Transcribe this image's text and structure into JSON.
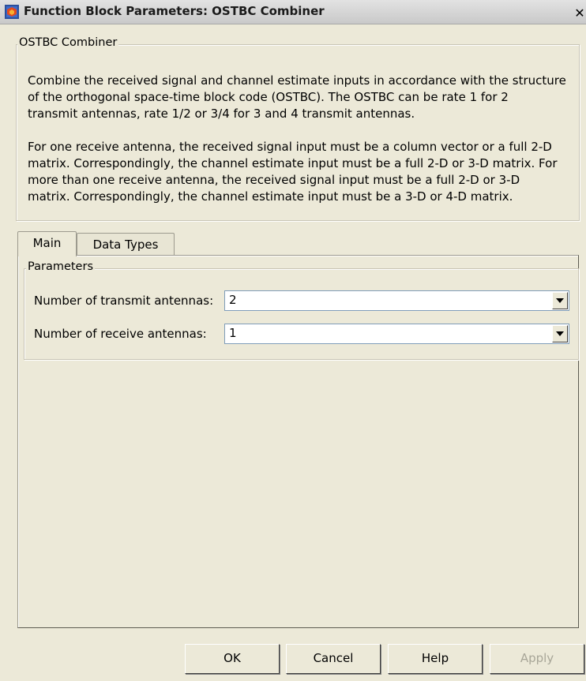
{
  "window": {
    "title": "Function Block Parameters: OSTBC Combiner",
    "close_glyph": "✕"
  },
  "block": {
    "name": "OSTBC Combiner",
    "description_lines": [
      "Combine the received signal and channel estimate inputs in accordance with the structure",
      "of the orthogonal space-time block code (OSTBC). The OSTBC can be rate 1 for 2",
      "transmit antennas, rate 1/2 or 3/4 for 3 and 4 transmit antennas.",
      "",
      "For one receive antenna, the received signal input must be a column vector or a full 2-D",
      "matrix. Correspondingly, the channel estimate input must be a full 2-D or 3-D matrix. For",
      "more than one receive antenna, the received signal input must be a full 2-D or 3-D",
      "matrix. Correspondingly, the channel estimate input must be a 3-D or 4-D matrix."
    ]
  },
  "tabs": [
    {
      "label": "Main",
      "active": true
    },
    {
      "label": "Data Types",
      "active": false
    }
  ],
  "parameters": {
    "group_label": "Parameters",
    "transmit": {
      "label": "Number of transmit antennas:",
      "value": "2"
    },
    "receive": {
      "label": "Number of receive antennas:",
      "value": "1"
    }
  },
  "buttons": {
    "ok": "OK",
    "cancel": "Cancel",
    "help": "Help",
    "apply": "Apply"
  },
  "icons": {
    "app": "simulink-block-icon",
    "close": "close-icon",
    "dropdown": "chevron-down-icon"
  },
  "colors": {
    "background": "#ece9d8",
    "disabled_text": "#a8a698",
    "combo_border": "#7f9db9"
  }
}
